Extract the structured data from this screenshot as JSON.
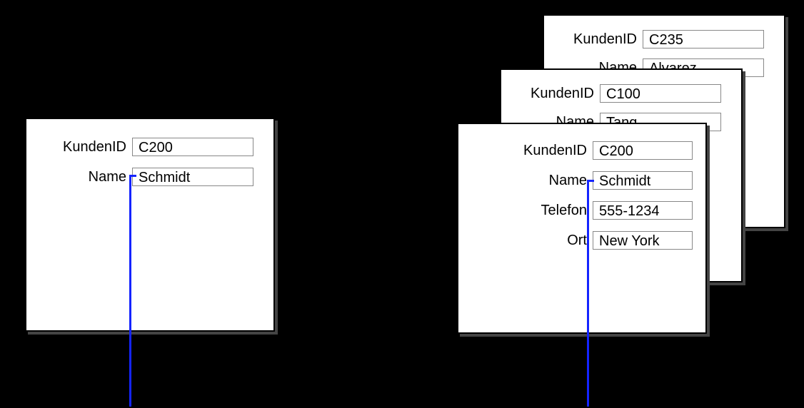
{
  "labels": {
    "kundenid": "KundenID",
    "name": "Name",
    "telefon": "Telefon",
    "ort": "Ort"
  },
  "left_form": {
    "kundenid": "C200",
    "name": "Schmidt"
  },
  "right_stack": {
    "back": {
      "kundenid": "C235",
      "name": "Alvarez"
    },
    "middle": {
      "kundenid": "C100",
      "name": "Tang"
    },
    "front": {
      "kundenid": "C200",
      "name": "Schmidt",
      "telefon": "555-1234",
      "ort": "New York"
    }
  }
}
